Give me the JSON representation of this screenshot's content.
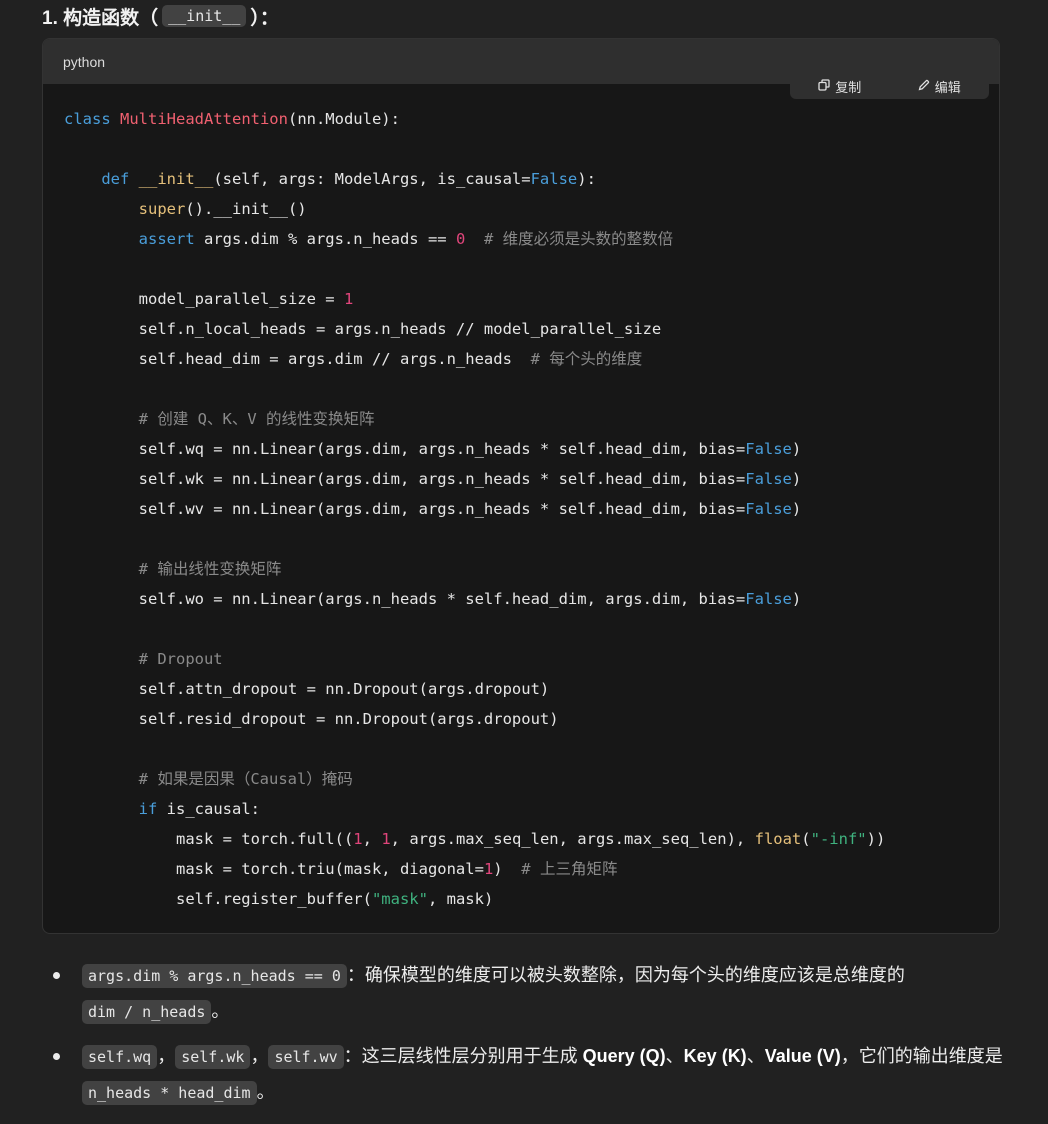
{
  "heading": {
    "prefix": "1. 构造函数（",
    "code": "__init__",
    "suffix": "）："
  },
  "code_block": {
    "language": "python",
    "copy_label": "复制",
    "edit_label": "编辑",
    "lines": [
      [
        [
          "kw",
          "class "
        ],
        [
          "fn",
          "MultiHeadAttention"
        ],
        [
          "",
          "(nn.Module):"
        ]
      ],
      [],
      [
        [
          "",
          "    "
        ],
        [
          "kw",
          "def "
        ],
        [
          "bi",
          "__init__"
        ],
        [
          "",
          "(self, args: ModelArgs, is_causal="
        ],
        [
          "kw",
          "False"
        ],
        [
          "",
          "):"
        ]
      ],
      [
        [
          "",
          "        "
        ],
        [
          "bi",
          "super"
        ],
        [
          "",
          "().__init__()"
        ]
      ],
      [
        [
          "",
          "        "
        ],
        [
          "kw",
          "assert"
        ],
        [
          "",
          " args.dim % args.n_heads == "
        ],
        [
          "num",
          "0"
        ],
        [
          "",
          "  "
        ],
        [
          "cm",
          "# 维度必须是头数的整数倍"
        ]
      ],
      [],
      [
        [
          "",
          "        model_parallel_size = "
        ],
        [
          "num",
          "1"
        ]
      ],
      [
        [
          "",
          "        self.n_local_heads = args.n_heads // model_parallel_size"
        ]
      ],
      [
        [
          "",
          "        self.head_dim = args.dim // args.n_heads  "
        ],
        [
          "cm",
          "# 每个头的维度"
        ]
      ],
      [],
      [
        [
          "",
          "        "
        ],
        [
          "cm",
          "# 创建 Q、K、V 的线性变换矩阵"
        ]
      ],
      [
        [
          "",
          "        self.wq = nn.Linear(args.dim, args.n_heads * self.head_dim, bias="
        ],
        [
          "kw",
          "False"
        ],
        [
          "",
          ")"
        ]
      ],
      [
        [
          "",
          "        self.wk = nn.Linear(args.dim, args.n_heads * self.head_dim, bias="
        ],
        [
          "kw",
          "False"
        ],
        [
          "",
          ")"
        ]
      ],
      [
        [
          "",
          "        self.wv = nn.Linear(args.dim, args.n_heads * self.head_dim, bias="
        ],
        [
          "kw",
          "False"
        ],
        [
          "",
          ")"
        ]
      ],
      [],
      [
        [
          "",
          "        "
        ],
        [
          "cm",
          "# 输出线性变换矩阵"
        ]
      ],
      [
        [
          "",
          "        self.wo = nn.Linear(args.n_heads * self.head_dim, args.dim, bias="
        ],
        [
          "kw",
          "False"
        ],
        [
          "",
          ")"
        ]
      ],
      [],
      [
        [
          "",
          "        "
        ],
        [
          "cm",
          "# Dropout"
        ]
      ],
      [
        [
          "",
          "        self.attn_dropout = nn.Dropout(args.dropout)"
        ]
      ],
      [
        [
          "",
          "        self.resid_dropout = nn.Dropout(args.dropout)"
        ]
      ],
      [],
      [
        [
          "",
          "        "
        ],
        [
          "cm",
          "# 如果是因果（Causal）掩码"
        ]
      ],
      [
        [
          "",
          "        "
        ],
        [
          "kw",
          "if"
        ],
        [
          "",
          " is_causal:"
        ]
      ],
      [
        [
          "",
          "            mask = torch.full(("
        ],
        [
          "num",
          "1"
        ],
        [
          "",
          ", "
        ],
        [
          "num",
          "1"
        ],
        [
          "",
          ", args.max_seq_len, args.max_seq_len), "
        ],
        [
          "bi",
          "float"
        ],
        [
          "",
          "("
        ],
        [
          "str",
          "\"-inf\""
        ],
        [
          "",
          "))"
        ]
      ],
      [
        [
          "",
          "            mask = torch.triu(mask, diagonal="
        ],
        [
          "num",
          "1"
        ],
        [
          "",
          ")  "
        ],
        [
          "cm",
          "# 上三角矩阵"
        ]
      ],
      [
        [
          "",
          "            self.register_buffer("
        ],
        [
          "str",
          "\"mask\""
        ],
        [
          "",
          ", mask)"
        ]
      ]
    ]
  },
  "bullets": [
    {
      "code1": "args.dim % args.n_heads == 0",
      "text1": "：确保模型的维度可以被头数整除，因为每个头的维度应该是总维度的",
      "code2": "dim / n_heads",
      "text2": "。"
    },
    {
      "code_a": "self.wq",
      "sep1": "，",
      "code_b": "self.wk",
      "sep2": "，",
      "code_c": "self.wv",
      "text1": "：这三层线性层分别用于生成 ",
      "q": "Query (Q)",
      "sep3": "、",
      "k": "Key (K)",
      "sep4": "、",
      "v": "Value (V)",
      "text2": "，它们的输出维度是",
      "code2": "n_heads * head_dim",
      "text3": "。"
    }
  ]
}
